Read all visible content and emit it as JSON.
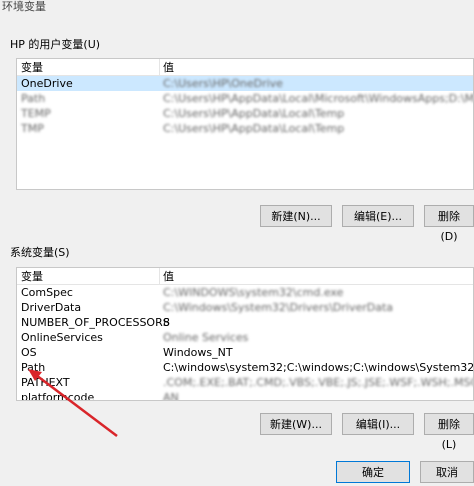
{
  "window": {
    "title": "环境变量"
  },
  "user_vars": {
    "label": "HP 的用户变量(U)",
    "columns": [
      "变量",
      "值"
    ],
    "rows": [
      {
        "name": "OneDrive",
        "value": "C:\\Users\\HP\\OneDrive"
      },
      {
        "name": "Path",
        "value": "C:\\Users\\HP\\AppData\\Local\\Microsoft\\WindowsApps;D:\\Microsof..."
      },
      {
        "name": "TEMP",
        "value": "C:\\Users\\HP\\AppData\\Local\\Temp"
      },
      {
        "name": "TMP",
        "value": "C:\\Users\\HP\\AppData\\Local\\Temp"
      }
    ],
    "buttons": {
      "new": "新建(N)...",
      "edit": "编辑(E)...",
      "delete": "删除(D)"
    }
  },
  "system_vars": {
    "label": "系统变量(S)",
    "columns": [
      "变量",
      "值"
    ],
    "rows": [
      {
        "name": "ComSpec",
        "value": "C:\\WINDOWS\\system32\\cmd.exe"
      },
      {
        "name": "DriverData",
        "value": "C:\\Windows\\System32\\Drivers\\DriverData"
      },
      {
        "name": "NUMBER_OF_PROCESSORS",
        "value": "8"
      },
      {
        "name": "OnlineServices",
        "value": "Online Services"
      },
      {
        "name": "OS",
        "value": "Windows_NT"
      },
      {
        "name": "Path",
        "value": "C:\\windows\\system32;C:\\windows;C:\\windows\\System32\\Wbem;C:..."
      },
      {
        "name": "PATHEXT",
        "value": ".COM;.EXE;.BAT;.CMD;.VBS;.VBE;.JS;.JSE;.WSF;.WSH;.MSC"
      },
      {
        "name": "platformcode",
        "value": "AN"
      }
    ],
    "buttons": {
      "new": "新建(W)...",
      "edit": "编辑(I)...",
      "delete": "删除(L)"
    }
  },
  "dialog_buttons": {
    "ok": "确定",
    "cancel": "取消"
  }
}
